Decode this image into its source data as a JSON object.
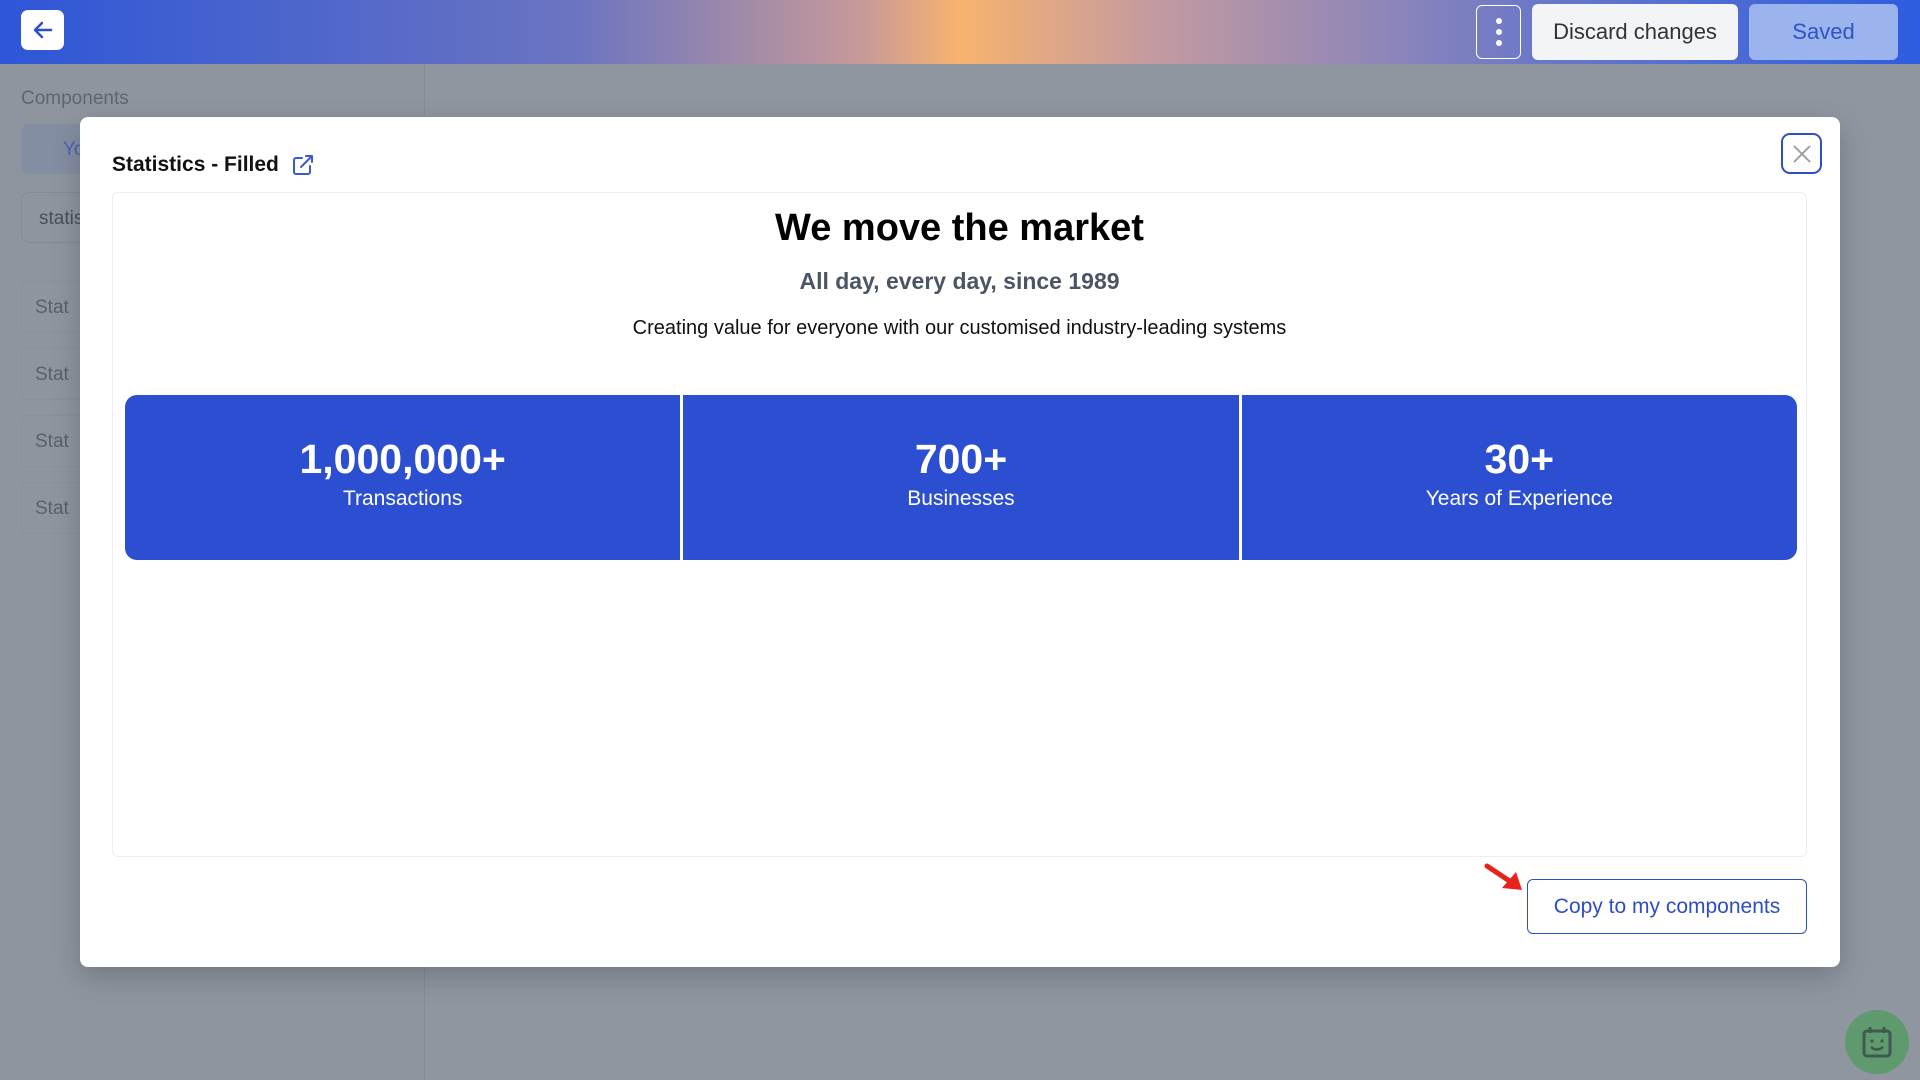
{
  "topbar": {
    "back_icon": "arrow-left-icon",
    "more_icon": "vertical-dots-icon",
    "discard_label": "Discard changes",
    "saved_label": "Saved"
  },
  "sidebar": {
    "title": "Components",
    "tab_label": "Yo",
    "search_value": "statis",
    "items": [
      "Stat",
      "Stat",
      "Stat",
      "Stat"
    ]
  },
  "modal": {
    "title": "Statistics - Filled",
    "open_external_icon": "external-link-icon",
    "close_icon": "close-icon",
    "preview": {
      "heading": "We move the market",
      "subheading": "All day, every day, since 1989",
      "description": "Creating value for everyone with our customised industry-leading systems",
      "stats": [
        {
          "value": "1,000,000+",
          "label": "Transactions"
        },
        {
          "value": "700+",
          "label": "Businesses"
        },
        {
          "value": "30+",
          "label": "Years of Experience"
        }
      ]
    },
    "copy_label": "Copy to my components"
  },
  "colors": {
    "accent": "#2e4fc4",
    "stat_bg": "#2b4fd0",
    "annotation_arrow": "#e8231c"
  },
  "assistant_icon": "robot-calendar-icon"
}
